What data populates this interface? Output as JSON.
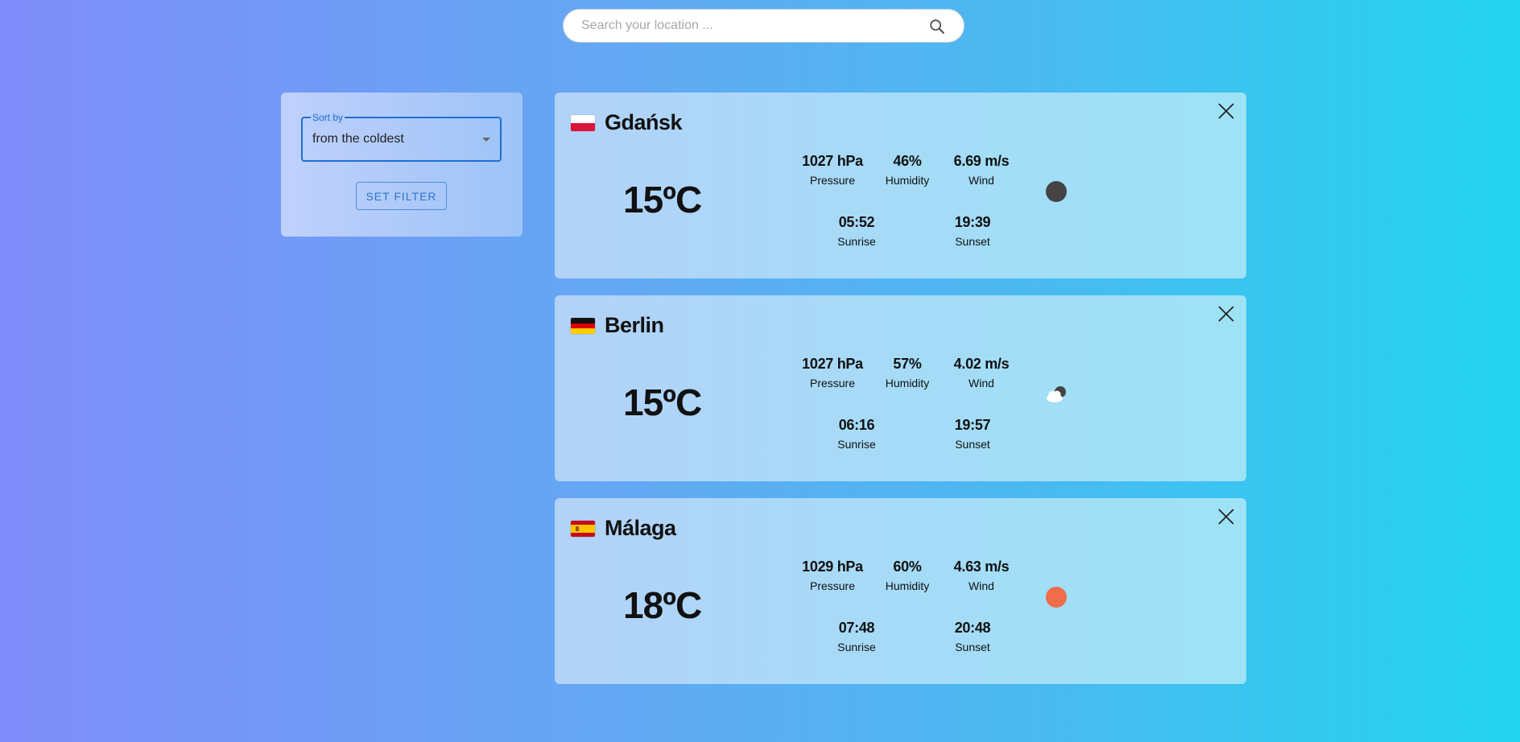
{
  "search": {
    "placeholder": "Search your location ..."
  },
  "filter": {
    "sort_label": "Sort by",
    "sort_value": "from the coldest",
    "set_filter_label": "SET FILTER"
  },
  "cards": [
    {
      "city": "Gdańsk",
      "country_flag": "poland-flag",
      "temperature": "15ºC",
      "pressure": "1027 hPa",
      "pressure_label": "Pressure",
      "humidity": "46%",
      "humidity_label": "Humidity",
      "wind": "6.69 m/s",
      "wind_label": "Wind",
      "sunrise": "05:52",
      "sunrise_label": "Sunrise",
      "sunset": "19:39",
      "sunset_label": "Sunset",
      "weather_icon": "clear-night-icon"
    },
    {
      "city": "Berlin",
      "country_flag": "germany-flag",
      "temperature": "15ºC",
      "pressure": "1027 hPa",
      "pressure_label": "Pressure",
      "humidity": "57%",
      "humidity_label": "Humidity",
      "wind": "4.02 m/s",
      "wind_label": "Wind",
      "sunrise": "06:16",
      "sunrise_label": "Sunrise",
      "sunset": "19:57",
      "sunset_label": "Sunset",
      "weather_icon": "partly-cloudy-night-icon"
    },
    {
      "city": "Málaga",
      "country_flag": "spain-flag",
      "temperature": "18ºC",
      "pressure": "1029 hPa",
      "pressure_label": "Pressure",
      "humidity": "60%",
      "humidity_label": "Humidity",
      "wind": "4.63 m/s",
      "wind_label": "Wind",
      "sunrise": "07:48",
      "sunrise_label": "Sunrise",
      "sunset": "20:48",
      "sunset_label": "Sunset",
      "weather_icon": "clear-day-icon"
    }
  ],
  "colors": {
    "accent": "#1e6fd0",
    "night_icon": "#444444",
    "sun_icon": "#ef6d4a"
  }
}
